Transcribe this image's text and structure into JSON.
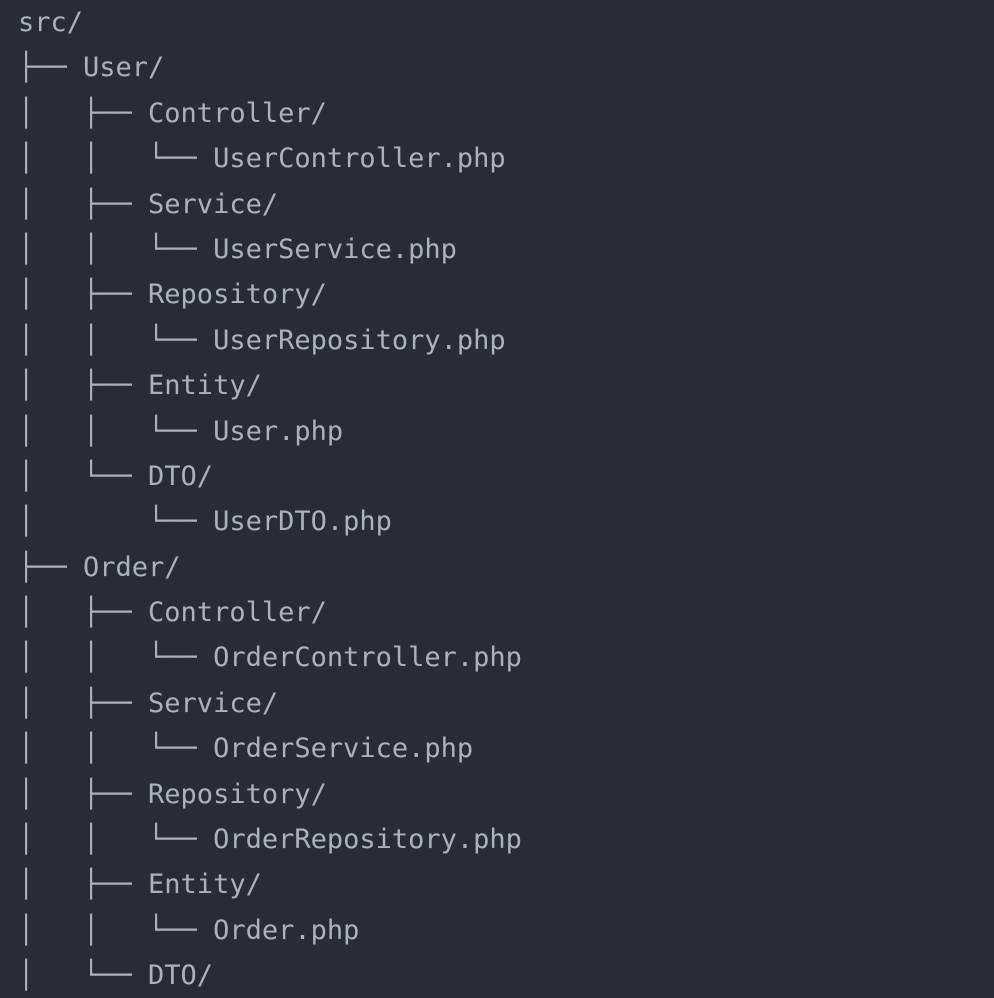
{
  "tree": {
    "lines": [
      "src/",
      "├── User/",
      "│   ├── Controller/",
      "│   │   └── UserController.php",
      "│   ├── Service/",
      "│   │   └── UserService.php",
      "│   ├── Repository/",
      "│   │   └── UserRepository.php",
      "│   ├── Entity/",
      "│   │   └── User.php",
      "│   └── DTO/",
      "│       └── UserDTO.php",
      "├── Order/",
      "│   ├── Controller/",
      "│   │   └── OrderController.php",
      "│   ├── Service/",
      "│   │   └── OrderService.php",
      "│   ├── Repository/",
      "│   │   └── OrderRepository.php",
      "│   ├── Entity/",
      "│   │   └── Order.php",
      "│   └── DTO/"
    ]
  },
  "colors": {
    "background": "#282c34",
    "text": "#abb2bf"
  }
}
